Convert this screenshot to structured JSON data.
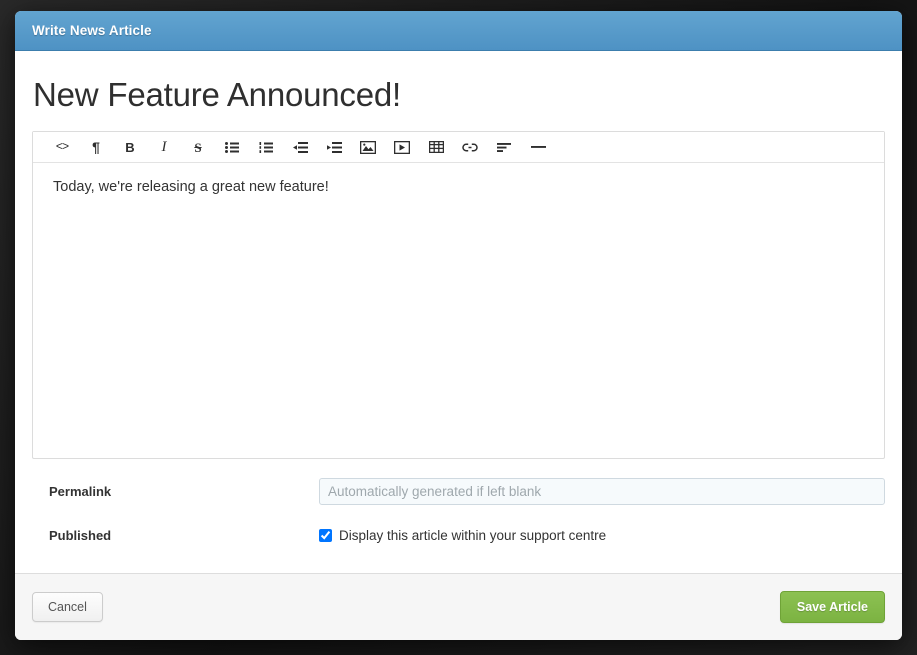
{
  "window": {
    "title": "Write News Article"
  },
  "article": {
    "title": "New Feature Announced!",
    "body": "Today, we're releasing a great new feature!"
  },
  "toolbar": {
    "items": [
      {
        "name": "source-code-icon",
        "label": "<>"
      },
      {
        "name": "paragraph-icon",
        "label": "¶"
      },
      {
        "name": "bold-icon",
        "label": "B"
      },
      {
        "name": "italic-icon",
        "label": "I"
      },
      {
        "name": "strikethrough-icon",
        "label": "S"
      },
      {
        "name": "unordered-list-icon",
        "label": ""
      },
      {
        "name": "ordered-list-icon",
        "label": ""
      },
      {
        "name": "outdent-icon",
        "label": ""
      },
      {
        "name": "indent-icon",
        "label": ""
      },
      {
        "name": "insert-image-icon",
        "label": ""
      },
      {
        "name": "insert-video-icon",
        "label": ""
      },
      {
        "name": "insert-table-icon",
        "label": ""
      },
      {
        "name": "insert-link-icon",
        "label": ""
      },
      {
        "name": "align-left-icon",
        "label": ""
      },
      {
        "name": "horizontal-rule-icon",
        "label": ""
      }
    ]
  },
  "form": {
    "permalink": {
      "label": "Permalink",
      "value": "",
      "placeholder": "Automatically generated if left blank"
    },
    "published": {
      "label": "Published",
      "checkbox_label": "Display this article within your support centre",
      "checked": true
    }
  },
  "footer": {
    "cancel_label": "Cancel",
    "save_label": "Save Article"
  },
  "colors": {
    "titlebar_blue": "#4e92c4",
    "titlebar_blue_light": "#62a4d0",
    "save_green": "#7cb342",
    "backdrop": "#1a1a1a",
    "input_background": "#f6fafc"
  }
}
